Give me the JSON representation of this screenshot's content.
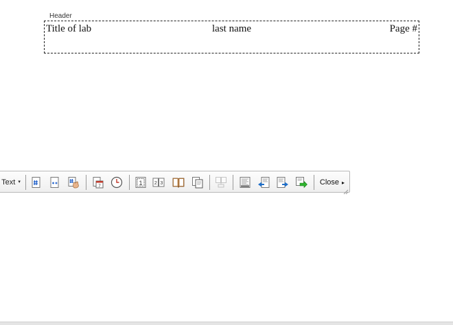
{
  "header": {
    "tag_label": "Header",
    "left_text": "Title of lab",
    "center_text": "last name",
    "right_text": "Page #"
  },
  "toolbar": {
    "text_dropdown_label": "Text",
    "text_dropdown_arrow": "▾",
    "close_label": "Close",
    "close_arrow": "▸",
    "icons": [
      "insert-page-number-icon",
      "insert-page-count-icon",
      "format-page-number-icon",
      "insert-date-icon",
      "insert-time-icon",
      "page-setup-icon",
      "same-as-previous-icon",
      "toggle-document-text-icon",
      "different-first-page-icon",
      "link-to-previous-icon",
      "switch-header-footer-icon",
      "show-previous-icon",
      "show-next-icon",
      "next-section-icon"
    ]
  }
}
